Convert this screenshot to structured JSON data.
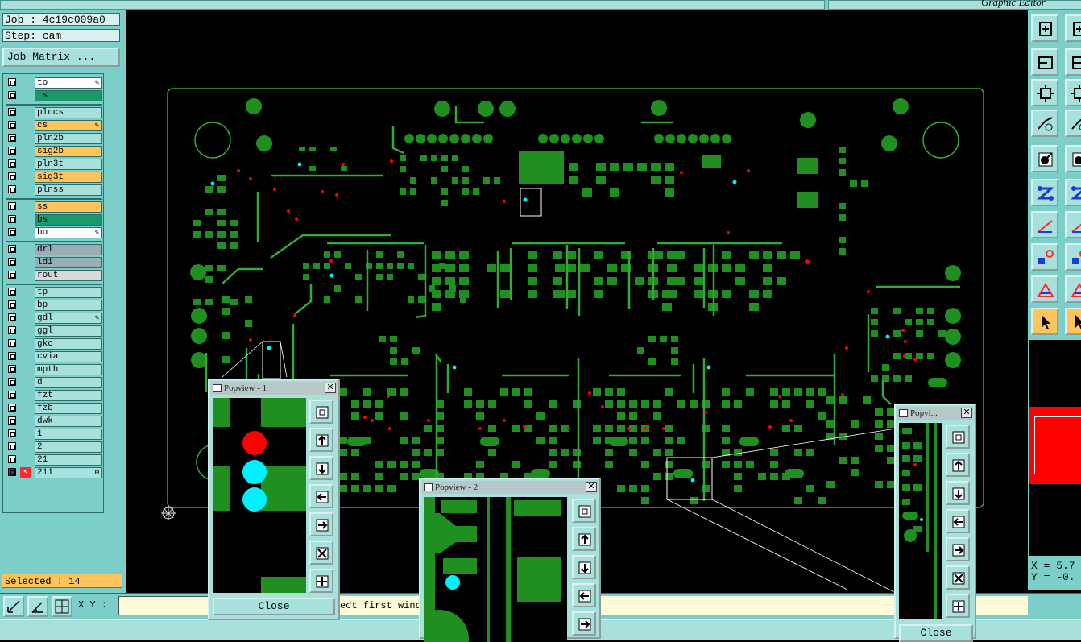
{
  "app": {
    "window_title": "Graphic Editor"
  },
  "job": {
    "job_label": "Job : 4c19c009a0",
    "step_label": "Step: cam",
    "job_matrix_button": "Job Matrix ..."
  },
  "layers": {
    "group1": [
      {
        "name": "to",
        "color": "#ffffff",
        "mark": "✎"
      },
      {
        "name": "ts",
        "color": "#1a9a6c",
        "mark": ""
      }
    ],
    "group2": [
      {
        "name": "plncs",
        "color": "#a8e0dc",
        "mark": ""
      },
      {
        "name": "cs",
        "color": "#ffc55c",
        "mark": "✎"
      },
      {
        "name": "pln2b",
        "color": "#a8e0dc",
        "mark": ""
      },
      {
        "name": "sig2b",
        "color": "#ffc55c",
        "mark": ""
      },
      {
        "name": "pln3t",
        "color": "#a8e0dc",
        "mark": ""
      },
      {
        "name": "sig3t",
        "color": "#ffc55c",
        "mark": ""
      },
      {
        "name": "plnss",
        "color": "#a8e0dc",
        "mark": ""
      }
    ],
    "group3": [
      {
        "name": "ss",
        "color": "#ffc55c",
        "mark": ""
      },
      {
        "name": "bs",
        "color": "#1a9a6c",
        "mark": ""
      },
      {
        "name": "bo",
        "color": "#ffffff",
        "mark": "✎"
      }
    ],
    "group4": [
      {
        "name": "drl",
        "color": "#9aaeb6",
        "mark": ""
      },
      {
        "name": "ldi",
        "color": "#9aaeb6",
        "mark": ""
      },
      {
        "name": "rout",
        "color": "#d9d9d9",
        "mark": ""
      }
    ],
    "group5": [
      {
        "name": "tp",
        "color": "#a8e0dc",
        "mark": ""
      },
      {
        "name": "bp",
        "color": "#a8e0dc",
        "mark": ""
      },
      {
        "name": "gdl",
        "color": "#a8e0dc",
        "mark": "✎"
      },
      {
        "name": "ggl",
        "color": "#a8e0dc",
        "mark": ""
      },
      {
        "name": "gko",
        "color": "#a8e0dc",
        "mark": ""
      },
      {
        "name": "cvia",
        "color": "#a8e0dc",
        "mark": ""
      },
      {
        "name": "mpth",
        "color": "#a8e0dc",
        "mark": ""
      },
      {
        "name": "d",
        "color": "#a8e0dc",
        "mark": ""
      },
      {
        "name": "fzt",
        "color": "#a8e0dc",
        "mark": ""
      },
      {
        "name": "fzb",
        "color": "#a8e0dc",
        "mark": ""
      },
      {
        "name": "dwk",
        "color": "#a8e0dc",
        "mark": ""
      },
      {
        "name": "1",
        "color": "#a8e0dc",
        "mark": ""
      },
      {
        "name": "2",
        "color": "#a8e0dc",
        "mark": ""
      },
      {
        "name": "21",
        "color": "#a8e0dc",
        "mark": ""
      },
      {
        "name": "211",
        "color": "#a8e0dc",
        "mark": "⊞"
      }
    ]
  },
  "selection": {
    "label": "Selected : 14"
  },
  "coords": {
    "x": "X = 5.7",
    "y": "Y = -0."
  },
  "bottom": {
    "xy_label": "X Y :",
    "xy_value": "",
    "message": "ect first wind"
  },
  "popup1": {
    "title": "Popview - 1",
    "close_label": "Close"
  },
  "popup2": {
    "title": "Popview - 2"
  },
  "popup3": {
    "title": "Popvi...",
    "close_label": "Close"
  },
  "colors": {
    "board": "#1f8f1f",
    "outline": "#35a835",
    "pad_red": "#ff0000",
    "pad_cyan": "#00f0ff",
    "panel": "#7ccfc9",
    "highlight": "#ffc55c"
  }
}
